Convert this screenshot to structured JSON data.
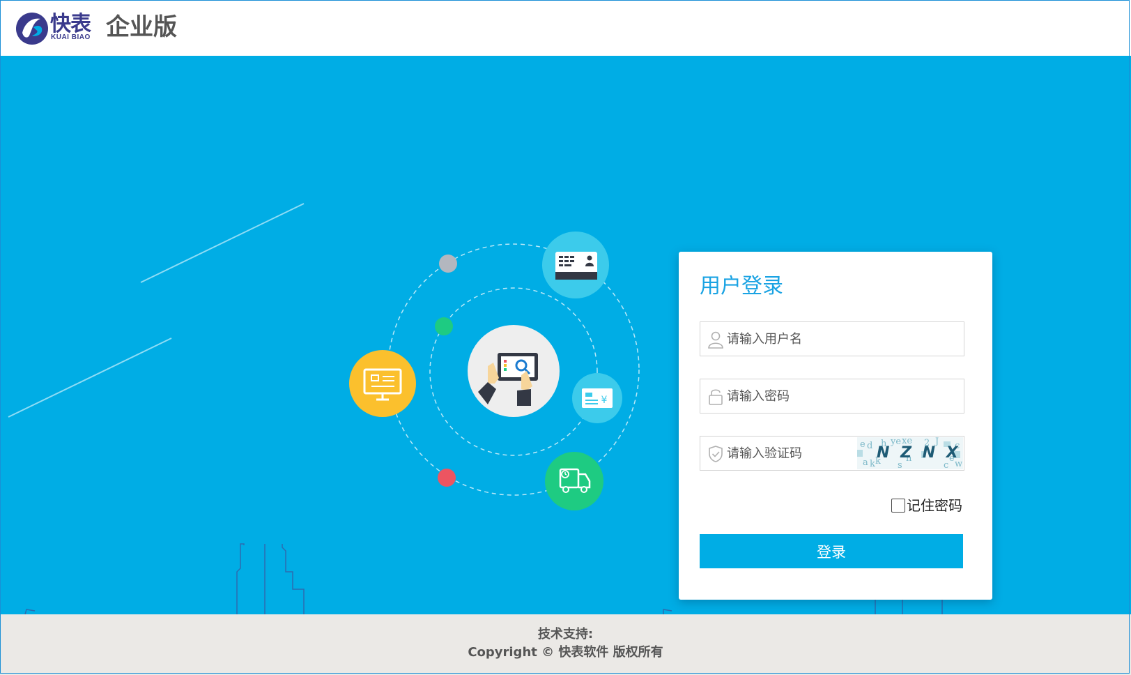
{
  "header": {
    "logo_cn": "快表",
    "logo_en": "KUAI BIAO",
    "edition": "企业版"
  },
  "login": {
    "title": "用户登录",
    "username": {
      "value": "",
      "placeholder": "请输入用户名"
    },
    "password": {
      "value": "",
      "placeholder": "请输入密码"
    },
    "captcha": {
      "value": "",
      "placeholder": "请输入验证码",
      "image_text": "N Z N X"
    },
    "remember_label": "记住密码",
    "remember_checked": false,
    "submit_label": "登录"
  },
  "footer": {
    "support": "技术支持:",
    "copyright": "Copyright © 快表软件 版权所有"
  },
  "colors": {
    "primary": "#00ade5",
    "title": "#1aa3e3",
    "footer_bg": "#ebe9e6",
    "logo": "#3a3a8c"
  }
}
